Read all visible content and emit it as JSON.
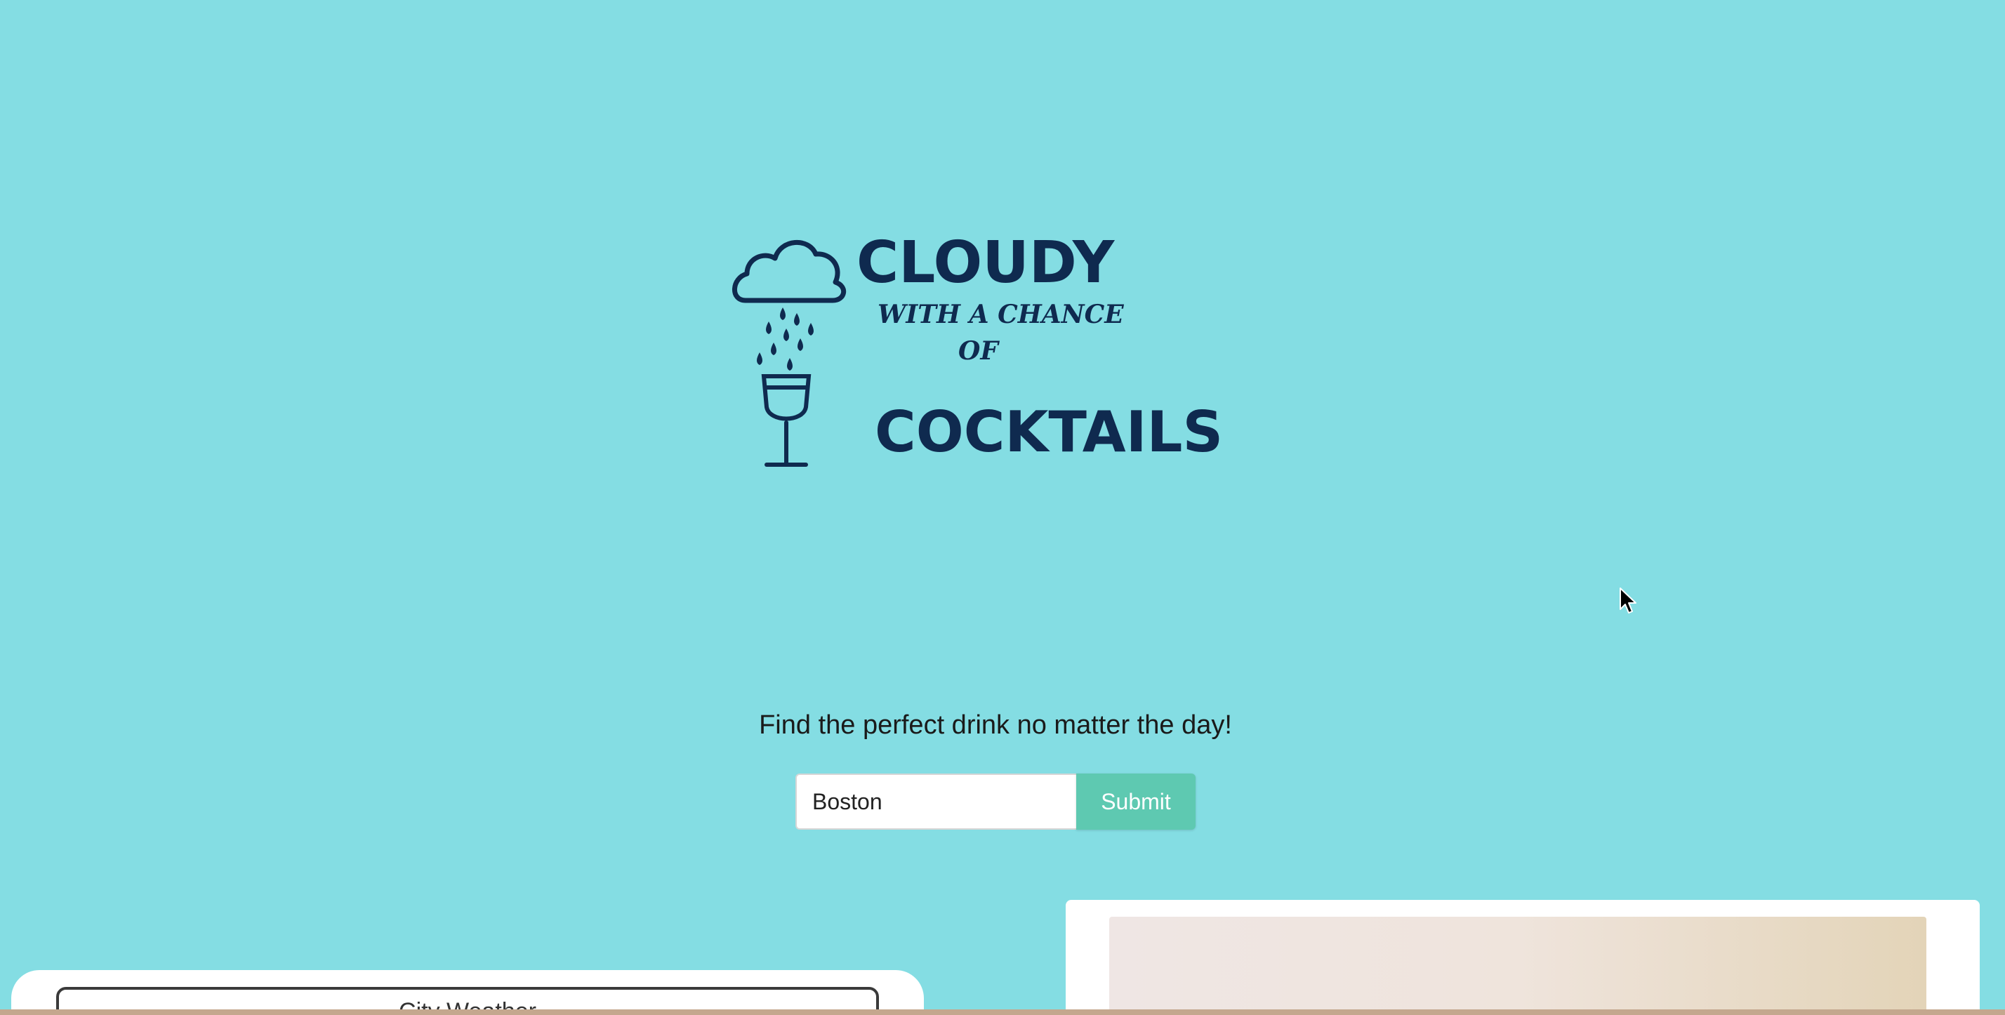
{
  "logo": {
    "word_top": "CLOUDY",
    "script_line1": "WITH A CHANCE",
    "script_line2": "OF",
    "word_bottom": "COCKTAILS"
  },
  "hero": {
    "tagline": "Find the perfect drink no matter the day!"
  },
  "search": {
    "city_value": "Boston",
    "submit_label": "Submit"
  },
  "weather_panel": {
    "title": "City Weather"
  },
  "colors": {
    "background": "#84dde3",
    "brand_navy": "#0f2a4f",
    "submit_button": "#5ec9b1"
  },
  "icons": [
    "cloud-icon",
    "raindrops-icon",
    "wine-glass-icon",
    "mouse-cursor-icon"
  ]
}
